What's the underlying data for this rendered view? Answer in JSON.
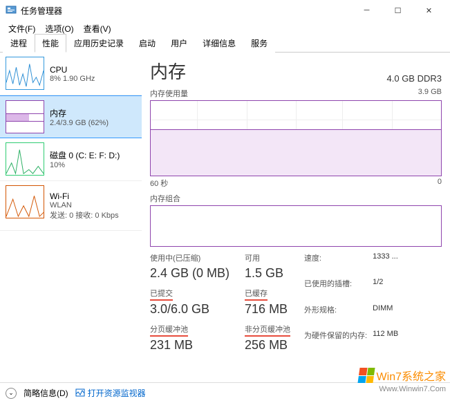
{
  "window": {
    "title": "任务管理器"
  },
  "menu": {
    "file": "文件(F)",
    "options": "选项(O)",
    "view": "查看(V)"
  },
  "tabs": {
    "processes": "进程",
    "performance": "性能",
    "history": "应用历史记录",
    "startup": "启动",
    "users": "用户",
    "details": "详细信息",
    "services": "服务"
  },
  "sidebar": {
    "cpu": {
      "title": "CPU",
      "sub": "8% 1.90 GHz"
    },
    "memory": {
      "title": "内存",
      "sub": "2.4/3.9 GB (62%)"
    },
    "disk": {
      "title": "磁盘 0 (C: E: F: D:)",
      "sub": "10%"
    },
    "wifi": {
      "title": "Wi-Fi",
      "sub1": "WLAN",
      "sub2": "发送: 0 接收: 0 Kbps"
    }
  },
  "main": {
    "title": "内存",
    "capacity": "4.0 GB DDR3",
    "graph1_label": "内存使用量",
    "graph1_max": "3.9 GB",
    "axis_left": "60 秒",
    "axis_right": "0",
    "graph2_label": "内存组合"
  },
  "stats": {
    "used": {
      "label": "使用中(已压缩)",
      "value": "2.4 GB (0 MB)"
    },
    "avail": {
      "label": "可用",
      "value": "1.5 GB"
    },
    "commit": {
      "label": "已提交",
      "value": "3.0/6.0 GB"
    },
    "cached": {
      "label": "已缓存",
      "value": "716 MB"
    },
    "paged": {
      "label": "分页缓冲池",
      "value": "231 MB"
    },
    "nonpaged": {
      "label": "非分页缓冲池",
      "value": "256 MB"
    }
  },
  "details": {
    "speed_l": "速度:",
    "speed_v": "1333 ...",
    "slots_l": "已使用的插槽:",
    "slots_v": "1/2",
    "form_l": "外形规格:",
    "form_v": "DIMM",
    "reserved_l": "为硬件保留的内存:",
    "reserved_v": "112 MB"
  },
  "footer": {
    "brief": "简略信息(D)",
    "monitor": "打开资源监视器"
  },
  "watermark": {
    "main": "Win7系统之家",
    "sub": "Www.Winwin7.Com"
  },
  "chart_data": {
    "type": "area",
    "title": "内存使用量",
    "xlabel": "60 秒",
    "ylabel": "GB",
    "ylim": [
      0,
      3.9
    ],
    "series": [
      {
        "name": "内存使用量",
        "values": [
          2.4,
          2.4,
          2.4,
          2.4,
          2.4,
          2.4,
          2.4,
          2.4,
          2.4,
          2.4
        ],
        "unit": "GB",
        "percent": 62
      }
    ]
  }
}
